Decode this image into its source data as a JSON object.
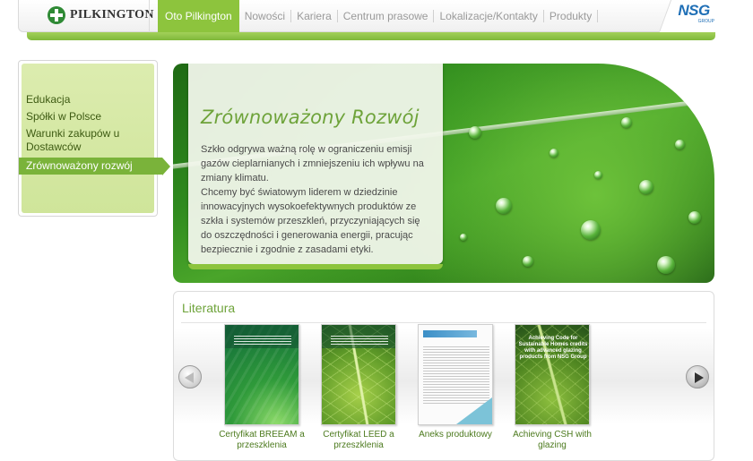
{
  "header": {
    "brand": "PILKINGTON",
    "nav": [
      {
        "label": "Oto Pilkington",
        "active": true
      },
      {
        "label": "Nowości",
        "active": false
      },
      {
        "label": "Kariera",
        "active": false
      },
      {
        "label": "Centrum prasowe",
        "active": false
      },
      {
        "label": "Lokalizacje/Kontakty",
        "active": false
      },
      {
        "label": "Produkty",
        "active": false
      }
    ],
    "group_logo": "NSG",
    "group_logo_sub": "GROUP"
  },
  "sidebar": {
    "items": [
      {
        "label": "Edukacja",
        "active": false
      },
      {
        "label": "Spółki w Polsce",
        "active": false
      },
      {
        "label": "Warunki zakupów u Dostawców",
        "active": false
      },
      {
        "label": "Zrównoważony rozwój",
        "active": true
      }
    ]
  },
  "hero": {
    "title": "Zrównoważony Rozwój",
    "paragraph1": "Szkło odgrywa ważną rolę w ograniczeniu emisji gazów cieplarnianych i zmniejszeniu ich wpływu na zmiany klimatu.",
    "paragraph2": "Chcemy być światowym liderem w dziedzinie innowacyjnych wysokoefektywnych produktów ze szkła i systemów przeszkleń, przyczyniających się do oszczędności i generowania energii, pracując bezpiecznie i zgodnie z zasadami etyki."
  },
  "literature": {
    "title": "Literatura",
    "items": [
      {
        "label": "Certyfikat BREEAM a przeszklenia",
        "icon": "breeam-brochure-cover"
      },
      {
        "label": "Certyfikat LEED a przeszklenia",
        "icon": "leed-brochure-cover"
      },
      {
        "label": "Aneks produktowy",
        "icon": "product-annex-cover"
      },
      {
        "label": "Achieving CSH with glazing",
        "icon": "csh-brochure-cover"
      }
    ],
    "csh_cover_text": "Achieving Code for Sustainable Homes credits with advanced glazing products from NSG Group"
  },
  "colors": {
    "accent_green": "#8dc43d",
    "title_green": "#6ea33a",
    "nsg_blue": "#1f6fb6"
  }
}
